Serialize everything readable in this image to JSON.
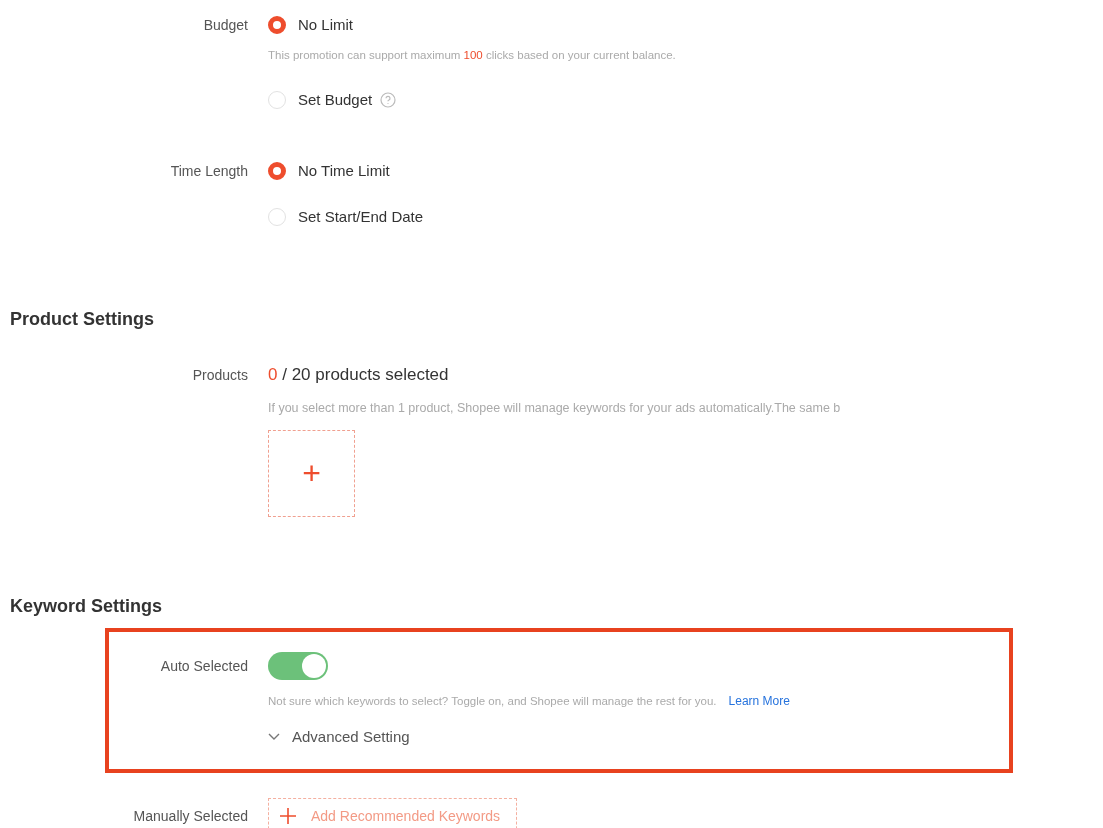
{
  "budget": {
    "label": "Budget",
    "options": [
      {
        "label": "No Limit",
        "selected": true,
        "info_icon": false,
        "hint": {
          "before": "This promotion can support maximum ",
          "highlight": "100",
          "after": " clicks based on your current balance."
        }
      },
      {
        "label": "Set Budget",
        "selected": false,
        "info_icon": true
      }
    ]
  },
  "time_length": {
    "label": "Time Length",
    "options": [
      {
        "label": "No Time Limit",
        "selected": true,
        "info_icon": false
      },
      {
        "label": "Set Start/End Date",
        "selected": false,
        "info_icon": false
      }
    ]
  },
  "product_settings": {
    "title": "Product Settings",
    "label": "Products",
    "count": "0",
    "count_text": " / 20 products selected",
    "hint": "If you select more than 1 product, Shopee will manage keywords for your ads automatically.The same b",
    "add_button": "+"
  },
  "keyword_settings": {
    "title": "Keyword Settings",
    "highlighted": true,
    "auto": {
      "label": "Auto Selected",
      "on": true,
      "hint": "Not sure which keywords to select? Toggle on, and Shopee will manage the rest for you.",
      "link": "Learn More",
      "advanced": "Advanced Setting",
      "expanded": false
    },
    "manual": {
      "label": "Manually Selected",
      "button": "Add Recommended Keywords"
    }
  }
}
